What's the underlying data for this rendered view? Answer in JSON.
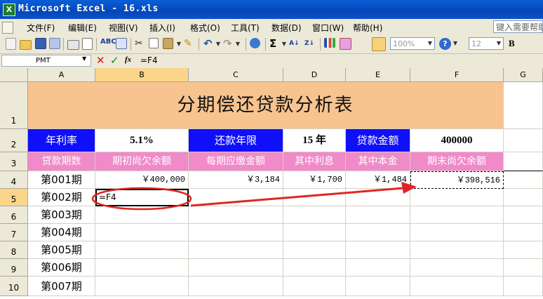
{
  "window": {
    "title": "Microsoft Excel - 16.xls",
    "app_icon": "excel-icon"
  },
  "menu": {
    "items": [
      "文件(F)",
      "编辑(E)",
      "视图(V)",
      "插入(I)",
      "格式(O)",
      "工具(T)",
      "数据(D)",
      "窗口(W)",
      "帮助(H)"
    ],
    "help_box": "键入需要帮助"
  },
  "toolbar": {
    "zoom": "100%",
    "font_size": "12",
    "bold_label": "B"
  },
  "formula_bar": {
    "name_box": "PMT",
    "formula": "=F4",
    "fx_label": "fx"
  },
  "grid": {
    "columns": [
      "A",
      "B",
      "C",
      "D",
      "E",
      "F",
      "G"
    ],
    "rows": [
      "1",
      "2",
      "3",
      "4",
      "5",
      "6",
      "7",
      "8",
      "9",
      "10"
    ],
    "title": "分期偿还贷款分析表",
    "row2": {
      "a": "年利率",
      "b": "5.1%",
      "c": "还款年限",
      "d": "15 年",
      "e": "贷款金额",
      "f": "400000"
    },
    "row3": [
      "贷款期数",
      "期初尚欠余额",
      "每期应缴金额",
      "其中利息",
      "其中本金",
      "期末尚欠余额"
    ],
    "row4": [
      "第001期",
      "￥400,000",
      "￥3,184",
      "￥1,700",
      "￥1,484",
      "￥398,516"
    ],
    "row5": {
      "a": "第002期",
      "b": "=F4"
    },
    "periods": [
      "第003期",
      "第004期",
      "第005期",
      "第006期",
      "第007期"
    ]
  },
  "colors": {
    "title_bg": "#f7c48f",
    "header_blue": "#0f0ffa",
    "header_pink": "#f08ac8",
    "annotation_red": "#e02525"
  }
}
